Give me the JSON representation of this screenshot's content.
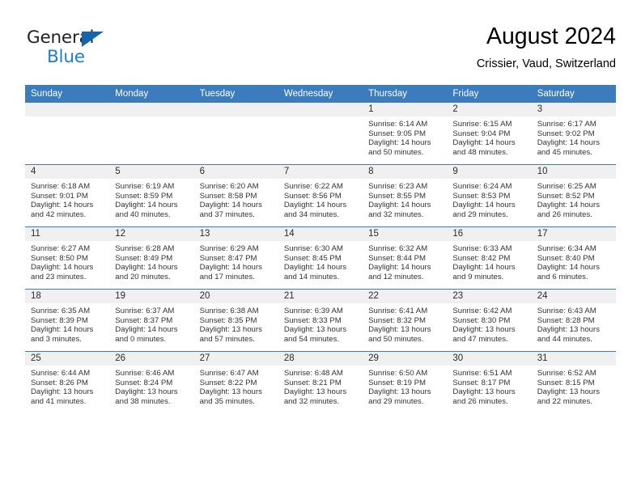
{
  "brand": {
    "name_top": "General",
    "name_bottom": "Blue",
    "triangle_color": "#1565AD",
    "blue_color": "#1A7FD4"
  },
  "header": {
    "title": "August 2024",
    "subtitle": "Crissier, Vaud, Switzerland"
  },
  "theme": {
    "header_row_bg": "#3A7CBE",
    "header_row_text": "#FFFFFF",
    "daynum_band_bg": "#F0F0F0",
    "cell_bg": "#FFFFFF",
    "row_divider": "#3A7CBE"
  },
  "weekday_headers": [
    "Sunday",
    "Monday",
    "Tuesday",
    "Wednesday",
    "Thursday",
    "Friday",
    "Saturday"
  ],
  "weeks": [
    [
      {
        "day": "",
        "sunrise": "",
        "sunset": "",
        "daylight_1": "",
        "daylight_2": ""
      },
      {
        "day": "",
        "sunrise": "",
        "sunset": "",
        "daylight_1": "",
        "daylight_2": ""
      },
      {
        "day": "",
        "sunrise": "",
        "sunset": "",
        "daylight_1": "",
        "daylight_2": ""
      },
      {
        "day": "",
        "sunrise": "",
        "sunset": "",
        "daylight_1": "",
        "daylight_2": ""
      },
      {
        "day": "1",
        "sunrise": "Sunrise: 6:14 AM",
        "sunset": "Sunset: 9:05 PM",
        "daylight_1": "Daylight: 14 hours",
        "daylight_2": "and 50 minutes."
      },
      {
        "day": "2",
        "sunrise": "Sunrise: 6:15 AM",
        "sunset": "Sunset: 9:04 PM",
        "daylight_1": "Daylight: 14 hours",
        "daylight_2": "and 48 minutes."
      },
      {
        "day": "3",
        "sunrise": "Sunrise: 6:17 AM",
        "sunset": "Sunset: 9:02 PM",
        "daylight_1": "Daylight: 14 hours",
        "daylight_2": "and 45 minutes."
      }
    ],
    [
      {
        "day": "4",
        "sunrise": "Sunrise: 6:18 AM",
        "sunset": "Sunset: 9:01 PM",
        "daylight_1": "Daylight: 14 hours",
        "daylight_2": "and 42 minutes."
      },
      {
        "day": "5",
        "sunrise": "Sunrise: 6:19 AM",
        "sunset": "Sunset: 8:59 PM",
        "daylight_1": "Daylight: 14 hours",
        "daylight_2": "and 40 minutes."
      },
      {
        "day": "6",
        "sunrise": "Sunrise: 6:20 AM",
        "sunset": "Sunset: 8:58 PM",
        "daylight_1": "Daylight: 14 hours",
        "daylight_2": "and 37 minutes."
      },
      {
        "day": "7",
        "sunrise": "Sunrise: 6:22 AM",
        "sunset": "Sunset: 8:56 PM",
        "daylight_1": "Daylight: 14 hours",
        "daylight_2": "and 34 minutes."
      },
      {
        "day": "8",
        "sunrise": "Sunrise: 6:23 AM",
        "sunset": "Sunset: 8:55 PM",
        "daylight_1": "Daylight: 14 hours",
        "daylight_2": "and 32 minutes."
      },
      {
        "day": "9",
        "sunrise": "Sunrise: 6:24 AM",
        "sunset": "Sunset: 8:53 PM",
        "daylight_1": "Daylight: 14 hours",
        "daylight_2": "and 29 minutes."
      },
      {
        "day": "10",
        "sunrise": "Sunrise: 6:25 AM",
        "sunset": "Sunset: 8:52 PM",
        "daylight_1": "Daylight: 14 hours",
        "daylight_2": "and 26 minutes."
      }
    ],
    [
      {
        "day": "11",
        "sunrise": "Sunrise: 6:27 AM",
        "sunset": "Sunset: 8:50 PM",
        "daylight_1": "Daylight: 14 hours",
        "daylight_2": "and 23 minutes."
      },
      {
        "day": "12",
        "sunrise": "Sunrise: 6:28 AM",
        "sunset": "Sunset: 8:49 PM",
        "daylight_1": "Daylight: 14 hours",
        "daylight_2": "and 20 minutes."
      },
      {
        "day": "13",
        "sunrise": "Sunrise: 6:29 AM",
        "sunset": "Sunset: 8:47 PM",
        "daylight_1": "Daylight: 14 hours",
        "daylight_2": "and 17 minutes."
      },
      {
        "day": "14",
        "sunrise": "Sunrise: 6:30 AM",
        "sunset": "Sunset: 8:45 PM",
        "daylight_1": "Daylight: 14 hours",
        "daylight_2": "and 14 minutes."
      },
      {
        "day": "15",
        "sunrise": "Sunrise: 6:32 AM",
        "sunset": "Sunset: 8:44 PM",
        "daylight_1": "Daylight: 14 hours",
        "daylight_2": "and 12 minutes."
      },
      {
        "day": "16",
        "sunrise": "Sunrise: 6:33 AM",
        "sunset": "Sunset: 8:42 PM",
        "daylight_1": "Daylight: 14 hours",
        "daylight_2": "and 9 minutes."
      },
      {
        "day": "17",
        "sunrise": "Sunrise: 6:34 AM",
        "sunset": "Sunset: 8:40 PM",
        "daylight_1": "Daylight: 14 hours",
        "daylight_2": "and 6 minutes."
      }
    ],
    [
      {
        "day": "18",
        "sunrise": "Sunrise: 6:35 AM",
        "sunset": "Sunset: 8:39 PM",
        "daylight_1": "Daylight: 14 hours",
        "daylight_2": "and 3 minutes."
      },
      {
        "day": "19",
        "sunrise": "Sunrise: 6:37 AM",
        "sunset": "Sunset: 8:37 PM",
        "daylight_1": "Daylight: 14 hours",
        "daylight_2": "and 0 minutes."
      },
      {
        "day": "20",
        "sunrise": "Sunrise: 6:38 AM",
        "sunset": "Sunset: 8:35 PM",
        "daylight_1": "Daylight: 13 hours",
        "daylight_2": "and 57 minutes."
      },
      {
        "day": "21",
        "sunrise": "Sunrise: 6:39 AM",
        "sunset": "Sunset: 8:33 PM",
        "daylight_1": "Daylight: 13 hours",
        "daylight_2": "and 54 minutes."
      },
      {
        "day": "22",
        "sunrise": "Sunrise: 6:41 AM",
        "sunset": "Sunset: 8:32 PM",
        "daylight_1": "Daylight: 13 hours",
        "daylight_2": "and 50 minutes."
      },
      {
        "day": "23",
        "sunrise": "Sunrise: 6:42 AM",
        "sunset": "Sunset: 8:30 PM",
        "daylight_1": "Daylight: 13 hours",
        "daylight_2": "and 47 minutes."
      },
      {
        "day": "24",
        "sunrise": "Sunrise: 6:43 AM",
        "sunset": "Sunset: 8:28 PM",
        "daylight_1": "Daylight: 13 hours",
        "daylight_2": "and 44 minutes."
      }
    ],
    [
      {
        "day": "25",
        "sunrise": "Sunrise: 6:44 AM",
        "sunset": "Sunset: 8:26 PM",
        "daylight_1": "Daylight: 13 hours",
        "daylight_2": "and 41 minutes."
      },
      {
        "day": "26",
        "sunrise": "Sunrise: 6:46 AM",
        "sunset": "Sunset: 8:24 PM",
        "daylight_1": "Daylight: 13 hours",
        "daylight_2": "and 38 minutes."
      },
      {
        "day": "27",
        "sunrise": "Sunrise: 6:47 AM",
        "sunset": "Sunset: 8:22 PM",
        "daylight_1": "Daylight: 13 hours",
        "daylight_2": "and 35 minutes."
      },
      {
        "day": "28",
        "sunrise": "Sunrise: 6:48 AM",
        "sunset": "Sunset: 8:21 PM",
        "daylight_1": "Daylight: 13 hours",
        "daylight_2": "and 32 minutes."
      },
      {
        "day": "29",
        "sunrise": "Sunrise: 6:50 AM",
        "sunset": "Sunset: 8:19 PM",
        "daylight_1": "Daylight: 13 hours",
        "daylight_2": "and 29 minutes."
      },
      {
        "day": "30",
        "sunrise": "Sunrise: 6:51 AM",
        "sunset": "Sunset: 8:17 PM",
        "daylight_1": "Daylight: 13 hours",
        "daylight_2": "and 26 minutes."
      },
      {
        "day": "31",
        "sunrise": "Sunrise: 6:52 AM",
        "sunset": "Sunset: 8:15 PM",
        "daylight_1": "Daylight: 13 hours",
        "daylight_2": "and 22 minutes."
      }
    ]
  ]
}
